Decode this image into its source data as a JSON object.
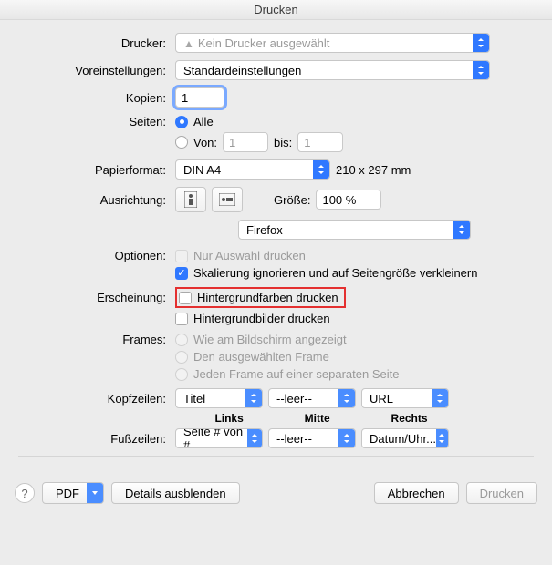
{
  "title": "Drucken",
  "labels": {
    "printer": "Drucker:",
    "presets": "Voreinstellungen:",
    "copies": "Kopien:",
    "pages": "Seiten:",
    "all": "Alle",
    "from": "Von:",
    "to": "bis:",
    "paper": "Papierformat:",
    "paper_dims": "210 x 297 mm",
    "orientation": "Ausrichtung:",
    "scale": "Größe:",
    "options": "Optionen:",
    "appearance": "Erscheinung:",
    "frames": "Frames:",
    "headers": "Kopfzeilen:",
    "footers": "Fußzeilen:",
    "left": "Links",
    "center": "Mitte",
    "right": "Rechts"
  },
  "values": {
    "printer": "Kein Drucker ausgewählt",
    "presets": "Standardeinstellungen",
    "copies": "1",
    "from": "1",
    "to": "1",
    "paper": "DIN A4",
    "scale": "100 %",
    "section": "Firefox",
    "header_left": "Titel",
    "header_center": "--leer--",
    "header_right": "URL",
    "footer_left": "Seite # von #",
    "footer_center": "--leer--",
    "footer_right": "Datum/Uhr..."
  },
  "options": {
    "selection_only": "Nur Auswahl drucken",
    "ignore_scaling": "Skalierung ignorieren und auf Seitengröße verkleinern",
    "bg_colors": "Hintergrundfarben drucken",
    "bg_images": "Hintergrundbilder drucken",
    "frame_screen": "Wie am Bildschirm angezeigt",
    "frame_selected": "Den ausgewählten Frame",
    "frame_each": "Jeden Frame auf einer separaten Seite"
  },
  "buttons": {
    "help": "?",
    "pdf": "PDF",
    "details": "Details ausblenden",
    "cancel": "Abbrechen",
    "print": "Drucken"
  }
}
